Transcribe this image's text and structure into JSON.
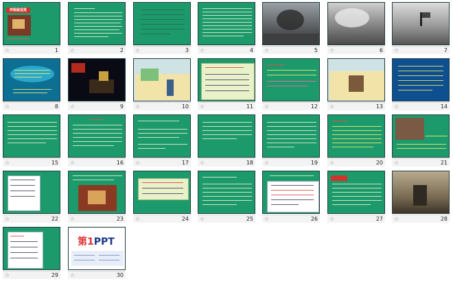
{
  "slides": [
    {
      "n": "1",
      "title": "炸毁敌坦克"
    },
    {
      "n": "2"
    },
    {
      "n": "3"
    },
    {
      "n": "4"
    },
    {
      "n": "5"
    },
    {
      "n": "6"
    },
    {
      "n": "7"
    },
    {
      "n": "8"
    },
    {
      "n": "9"
    },
    {
      "n": "10"
    },
    {
      "n": "11"
    },
    {
      "n": "12"
    },
    {
      "n": "13"
    },
    {
      "n": "14"
    },
    {
      "n": "15"
    },
    {
      "n": "16"
    },
    {
      "n": "17"
    },
    {
      "n": "18"
    },
    {
      "n": "19"
    },
    {
      "n": "20"
    },
    {
      "n": "21"
    },
    {
      "n": "22"
    },
    {
      "n": "23"
    },
    {
      "n": "24"
    },
    {
      "n": "25"
    },
    {
      "n": "26"
    },
    {
      "n": "27"
    },
    {
      "n": "28"
    },
    {
      "n": "29"
    },
    {
      "n": "30",
      "logo_text": "第1PPT"
    }
  ],
  "colors": {
    "slide_green": "#1d9a6c",
    "accent_red": "#d0342c",
    "panel_yellow": "#e9f1c8"
  }
}
